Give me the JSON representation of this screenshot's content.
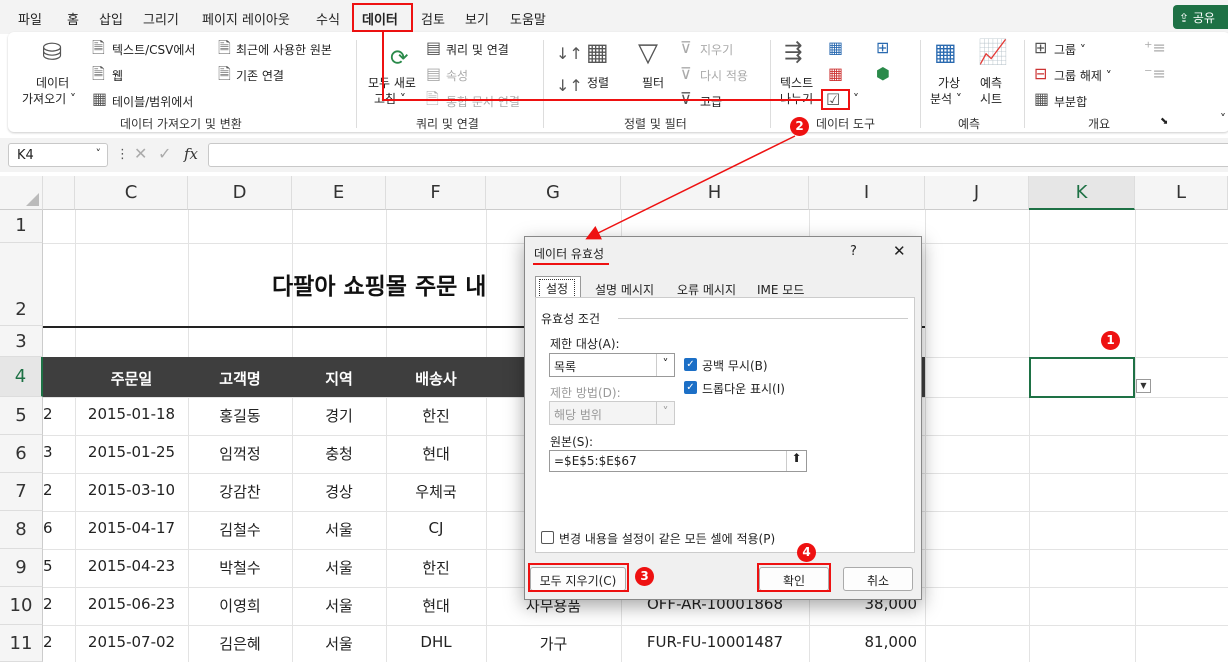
{
  "menu": {
    "tabs": [
      "파일",
      "홈",
      "삽입",
      "그리기",
      "페이지 레이아웃",
      "수식",
      "데이터",
      "검토",
      "보기",
      "도움말"
    ],
    "share": "공유"
  },
  "ribbon": {
    "get_data": {
      "btn": "데이터",
      "btn2": "가져오기",
      "text_csv": "텍스트/CSV에서",
      "web": "웹",
      "table_range": "테이블/범위에서",
      "recent": "최근에 사용한 원본",
      "existing": "기존 연결",
      "group": "데이터 가져오기 및 변환"
    },
    "queries": {
      "refresh_all": "모두 새로",
      "refresh_all2": "고침",
      "queries_connections": "쿼리 및 연결",
      "properties": "속성",
      "edit_links": "통합 문서 연결",
      "group": "쿼리 및 연결"
    },
    "sort_filter": {
      "sort": "정렬",
      "filter": "필터",
      "clear": "지우기",
      "reapply": "다시 적용",
      "advanced": "고급",
      "group": "정렬 및 필터"
    },
    "data_tools": {
      "text_to_columns": "텍스트",
      "text_to_columns2": "나누기",
      "group": "데이터 도구"
    },
    "forecast": {
      "whatif": "가상",
      "whatif2": "분석",
      "sheet": "예측",
      "sheet2": "시트",
      "group": "예측"
    },
    "outline": {
      "group_btn": "그룹",
      "ungroup": "그룹 해제",
      "subtotal": "부분합",
      "group": "개요"
    }
  },
  "formula_bar": {
    "name_box": "K4",
    "fx": "fx"
  },
  "columns": [
    "C",
    "D",
    "E",
    "F",
    "G",
    "H",
    "I",
    "J",
    "K",
    "L"
  ],
  "rows": [
    "1",
    "2",
    "3",
    "4",
    "5",
    "6",
    "7",
    "8",
    "9",
    "10",
    "11"
  ],
  "sheet_title": "다팔아 쇼핑몰 주문 내",
  "table_headers": [
    "주문일",
    "고객명",
    "지역",
    "배송사"
  ],
  "table_rows": [
    {
      "b": "2",
      "date": "2015-01-18",
      "name": "홍길동",
      "region": "경기",
      "carrier": "한진",
      "g": "",
      "h": "",
      "i": ""
    },
    {
      "b": "3",
      "date": "2015-01-25",
      "name": "임꺽정",
      "region": "충청",
      "carrier": "현대",
      "g": "",
      "h": "",
      "i": ""
    },
    {
      "b": "2",
      "date": "2015-03-10",
      "name": "강감찬",
      "region": "경상",
      "carrier": "우체국",
      "g": "",
      "h": "",
      "i": ""
    },
    {
      "b": "6",
      "date": "2015-04-17",
      "name": "김철수",
      "region": "서울",
      "carrier": "CJ",
      "g": "",
      "h": "",
      "i": ""
    },
    {
      "b": "5",
      "date": "2015-04-23",
      "name": "박철수",
      "region": "서울",
      "carrier": "한진",
      "g": "",
      "h": "",
      "i": ""
    },
    {
      "b": "2",
      "date": "2015-06-23",
      "name": "이영희",
      "region": "서울",
      "carrier": "현대",
      "g": "사무용품",
      "h": "OFF-AR-10001868",
      "i": "38,000"
    },
    {
      "b": "2",
      "date": "2015-07-02",
      "name": "김은혜",
      "region": "서울",
      "carrier": "DHL",
      "g": "가구",
      "h": "FUR-FU-10001487",
      "i": "81,000"
    }
  ],
  "dialog": {
    "title": "데이터 유효성",
    "help": "?",
    "tabs": [
      "설정",
      "설명 메시지",
      "오류 메시지",
      "IME 모드"
    ],
    "criteria_label": "유효성 조건",
    "allow_label": "제한 대상(A):",
    "allow_value": "목록",
    "data_label": "제한 방법(D):",
    "data_value": "해당 범위",
    "ignore_blank": "공백 무시(B)",
    "dropdown": "드롭다운 표시(I)",
    "source_label": "원본(S):",
    "source_value": "=$E$5:$E$67",
    "apply_all": "변경 내용을 설정이 같은 모든 셀에 적용(P)",
    "clear_all": "모두 지우기(C)",
    "ok": "확인",
    "cancel": "취소"
  },
  "badges": [
    "1",
    "2",
    "3",
    "4"
  ],
  "colors": {
    "accent": "#1e7145",
    "annotation": "#e11111",
    "header_band": "#3e3e3e"
  }
}
